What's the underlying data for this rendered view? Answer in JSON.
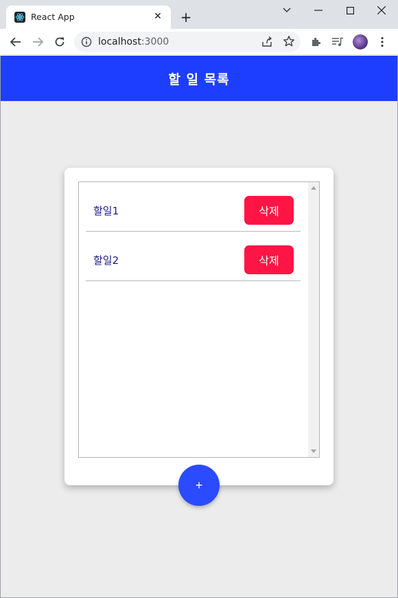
{
  "browser": {
    "tab_title": "React App",
    "tab_close_glyph": "✕",
    "new_tab_glyph": "+",
    "url_host": "localhost",
    "url_port": ":3000",
    "icons": [
      "react-favicon",
      "close-icon",
      "plus-icon",
      "chevron-down-icon",
      "minimize-icon",
      "maximize-icon",
      "close-window-icon",
      "back-icon",
      "forward-icon",
      "reload-icon",
      "info-icon",
      "share-icon",
      "star-icon",
      "extensions-icon",
      "media-icon",
      "kebab-menu-icon"
    ]
  },
  "app": {
    "header_title": "할 일 목록",
    "header_color": "#1e3eff",
    "todos": [
      {
        "text": "할일1",
        "delete_label": "삭제"
      },
      {
        "text": "할일2",
        "delete_label": "삭제"
      }
    ],
    "add_label": "+",
    "delete_color": "#ff1545",
    "add_color": "#2a4bff"
  }
}
